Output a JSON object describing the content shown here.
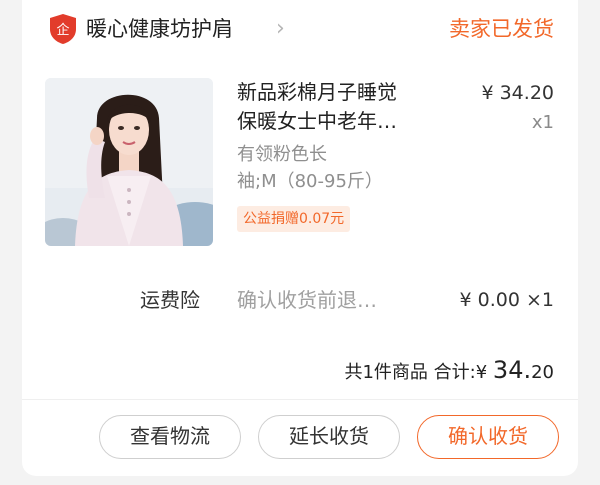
{
  "header": {
    "shop_name": "暖心健康坊护肩",
    "shop_badge_glyph": "企",
    "chevron": "›",
    "order_status": "卖家已发货"
  },
  "product": {
    "image_icon": "product-photo-woman-pink-shrug",
    "title_line1": "新品彩棉月子睡觉",
    "title_line2": "保暖女士中老年…",
    "price": "¥ 34.20",
    "qty": "x1",
    "spec_line1": "有领粉色长",
    "spec_line2": "袖;M（80-95斤）",
    "charity": "公益捐赠0.07元"
  },
  "insurance": {
    "label": "运费险",
    "desc": "确认收货前退…",
    "price": "¥ 0.00",
    "qty": "×1"
  },
  "total": {
    "count_text": "共1件商品",
    "sum_label": "合计:",
    "currency": "¥",
    "amount_int": "34.",
    "amount_dec": "20"
  },
  "actions": {
    "logistics": "查看物流",
    "extend": "延长收货",
    "confirm": "确认收货"
  },
  "colors": {
    "accent": "#f2682a",
    "badge_red": "#e23c2b"
  }
}
